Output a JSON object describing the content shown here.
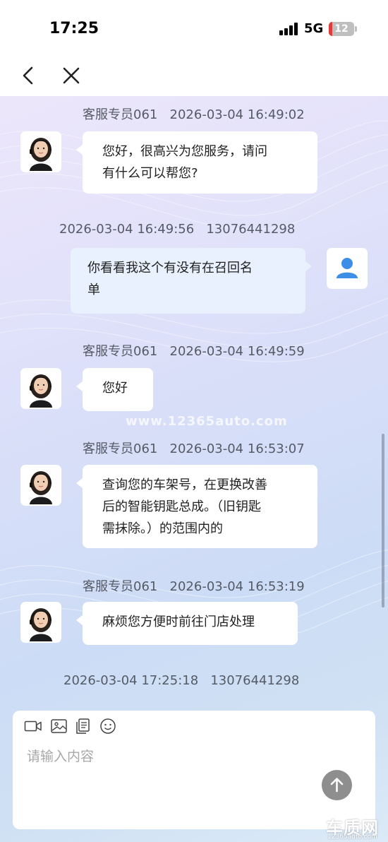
{
  "status_bar": {
    "time": "17:25",
    "network": "5G",
    "battery": "12"
  },
  "nav": {
    "back_icon": "chevron-left-icon",
    "close_icon": "close-icon"
  },
  "messages": [
    {
      "side": "agent",
      "sender": "客服专员061",
      "time": "2026-03-04 16:49:02",
      "lines": [
        "您好，很高兴为您服务，请问",
        "有什么可以帮您?"
      ]
    },
    {
      "side": "user",
      "time": "2026-03-04 16:49:56",
      "phone": "13076441298",
      "lines": [
        "你看看我这个有没有在召回名",
        "单"
      ]
    },
    {
      "side": "agent",
      "sender": "客服专员061",
      "time": "2026-03-04 16:49:59",
      "lines": [
        "您好"
      ]
    },
    {
      "side": "agent",
      "sender": "客服专员061",
      "time": "2026-03-04 16:53:07",
      "lines": [
        "查询您的车架号，在更换改善",
        "后的智能钥匙总成。（旧钥匙",
        "需抹除。）的范围内的"
      ]
    },
    {
      "side": "agent",
      "sender": "客服专员061",
      "time": "2026-03-04 16:53:19",
      "lines": [
        "麻烦您方便时前往门店处理"
      ]
    },
    {
      "side": "user",
      "time": "2026-03-04 17:25:18",
      "phone": "13076441298"
    }
  ],
  "watermark": "www.12365auto.com",
  "composer": {
    "placeholder": "请输入内容",
    "tools": [
      "video-icon",
      "image-icon",
      "file-icon",
      "emoji-icon"
    ],
    "send_icon": "arrow-up-icon"
  },
  "logo": {
    "text": "车质网",
    "sub": "12365auto.com"
  },
  "colors": {
    "user_bubble": "#e8f1fd",
    "agent_bubble": "#ffffff",
    "avatar_blue": "#3d8ee6",
    "send_button": "#8e8e8e"
  }
}
